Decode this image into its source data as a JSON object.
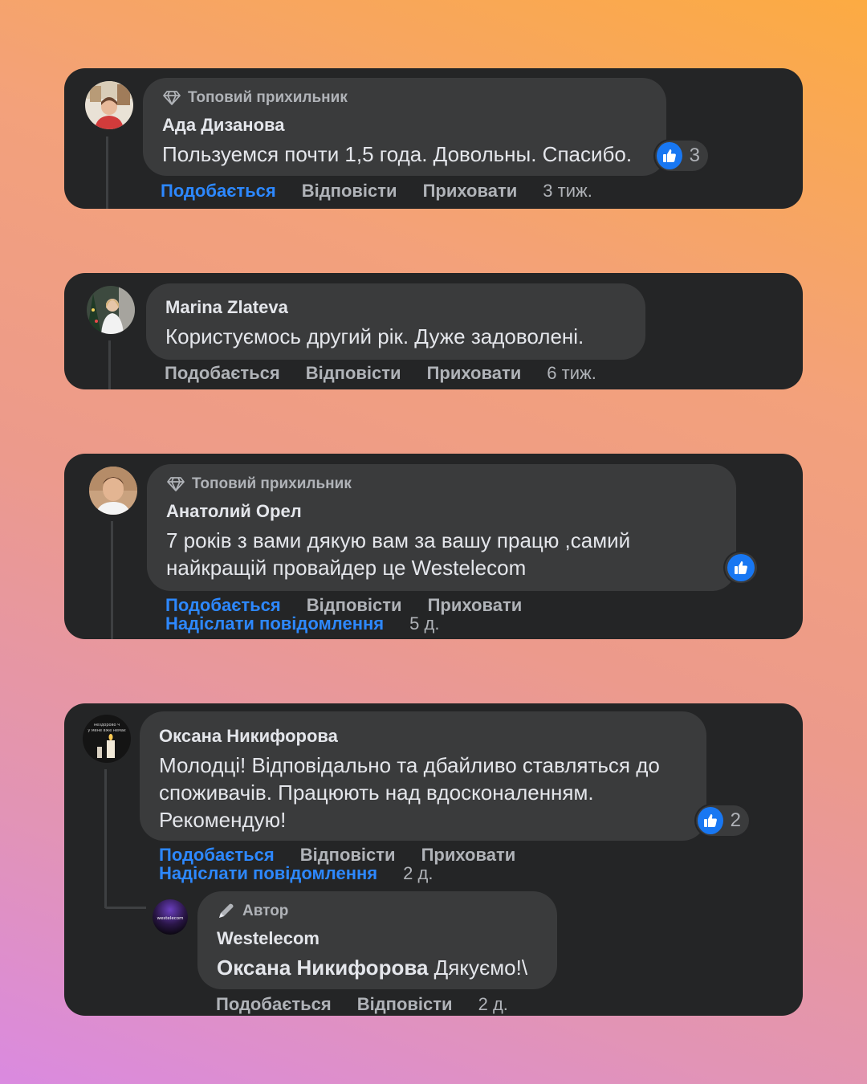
{
  "comments": [
    {
      "badge": "Топовий прихильник",
      "author": "Ада Дизанова",
      "text": "Пользуемся почти 1,5 года. Довольны. Спасибо.",
      "reaction_count": "3",
      "actions": {
        "like": "Подобається",
        "reply": "Відповісти",
        "hide": "Приховати",
        "time": "3 тиж."
      }
    },
    {
      "author": "Marina Zlateva",
      "text": "Користуємось другий рік. Дуже задоволені.",
      "actions": {
        "like": "Подобається",
        "reply": "Відповісти",
        "hide": "Приховати",
        "time": "6 тиж."
      }
    },
    {
      "badge": "Топовий прихильник",
      "author": "Анатолий Орел",
      "text_line1": "7 років з вами дякую вам за вашу працю ,самий",
      "text_line2": "найкращій провайдер це Westelecom",
      "actions": {
        "like": "Подобається",
        "reply": "Відповісти",
        "hide": "Приховати",
        "message": "Надіслати повідомлення",
        "time": "5 д."
      }
    },
    {
      "author": "Оксана Никифорова",
      "text_line1": "Молодці! Відповідально та дбайливо ставляться до",
      "text_line2": "споживачів. Працюють над вдосконаленням.",
      "text_line3": "Рекомендую!",
      "reaction_count": "2",
      "actions": {
        "like": "Подобається",
        "reply": "Відповісти",
        "hide": "Приховати",
        "message": "Надіслати повідомлення",
        "time": "2 д."
      },
      "avatar_text": "нездорово ч у мене вже немає",
      "reply": {
        "badge": "Автор",
        "author": "Westelecom",
        "mention": "Оксана Никифорова",
        "text": " Дякуємо!\\",
        "avatar_text": "westelecom",
        "actions": {
          "like": "Подобається",
          "reply": "Відповісти",
          "time": "2 д."
        }
      }
    }
  ],
  "colors": {
    "card": "#242526",
    "bubble": "#3a3b3c",
    "text": "#e4e6eb",
    "muted": "#b0b3b8",
    "link": "#2d88ff",
    "like": "#1877f2"
  },
  "icons": [
    "diamond-icon",
    "pencil-icon",
    "thumbs-up-icon"
  ]
}
